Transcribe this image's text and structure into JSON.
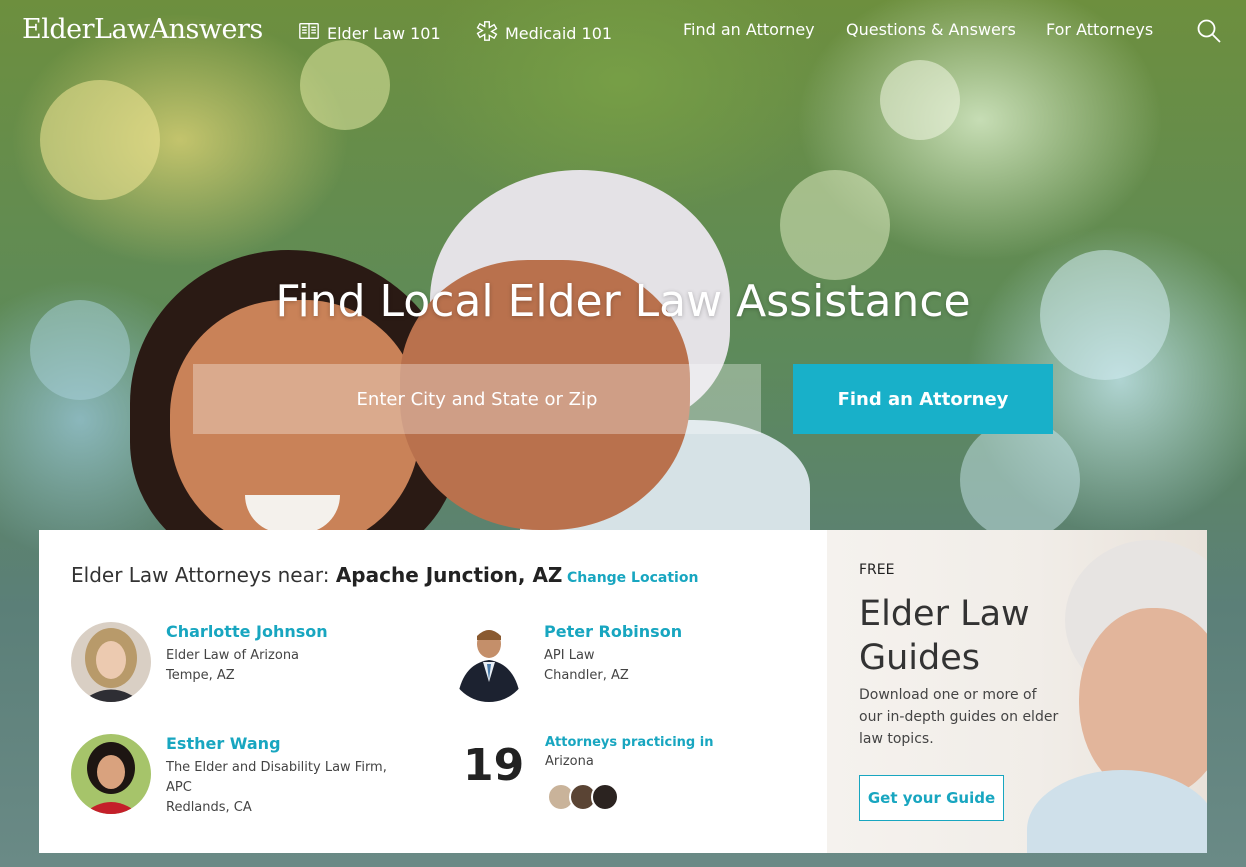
{
  "nav": {
    "logo": "ElderLawAnswers",
    "elder_law_101": "Elder Law 101",
    "medicaid_101": "Medicaid 101",
    "find_attorney": "Find an Attorney",
    "questions_answers": "Questions & Answers",
    "for_attorneys": "For Attorneys",
    "search_icon": "search-icon"
  },
  "hero": {
    "title": "Find Local Elder Law Assistance",
    "search_placeholder": "Enter City and State or Zip",
    "find_button": "Find an Attorney"
  },
  "attorneys": {
    "heading_prefix": "Elder Law Attorneys near: ",
    "location": "Apache Junction, AZ",
    "change_location": "Change Location",
    "list": [
      {
        "name": "Charlotte Johnson",
        "firm": "Elder Law of Arizona",
        "city": "Tempe, AZ"
      },
      {
        "name": "Peter Robinson",
        "firm": "API Law",
        "city": "Chandler, AZ"
      },
      {
        "name": "Esther Wang",
        "firm_line1": "The Elder and Disability Law Firm,",
        "firm_line2": "APC",
        "city": "Redlands, CA"
      }
    ],
    "count": "19",
    "count_label": "Attorneys practicing in",
    "count_state": "Arizona"
  },
  "guides": {
    "free": "FREE",
    "title": "Elder Law Guides",
    "description": "Download one or more of our in-depth guides on elder law topics.",
    "button": "Get your Guide"
  },
  "colors": {
    "accent": "#18b0c9",
    "link": "#18a6c0"
  }
}
